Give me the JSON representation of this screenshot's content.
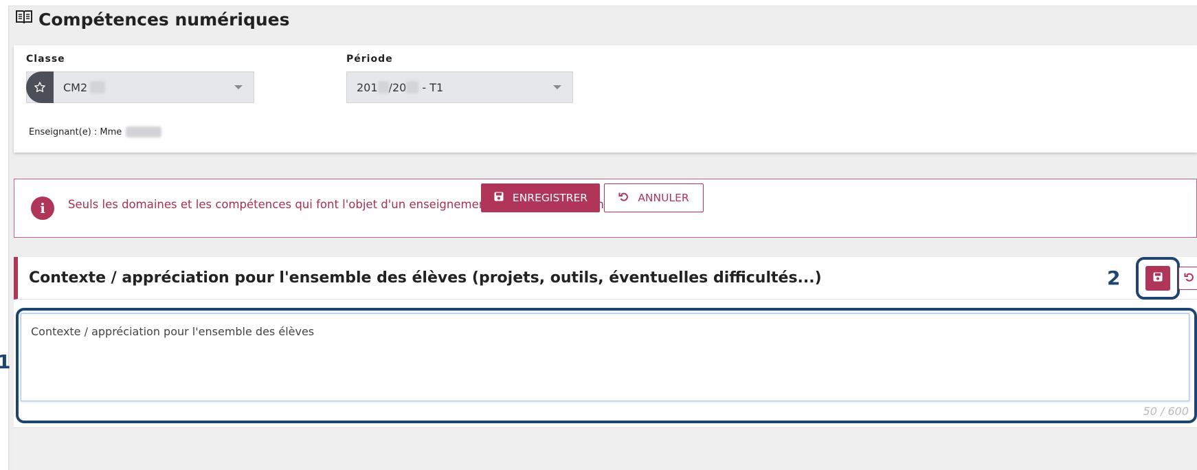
{
  "page": {
    "title": "Compétences numériques",
    "title_icon": "book-open-icon"
  },
  "filters": {
    "classe_label": "Classe",
    "classe_value": "CM2",
    "classe_icon": "star-icon",
    "periode_label": "Période",
    "periode_value_part1": "201",
    "periode_value_part2": "/20",
    "periode_value_part3": " - T1",
    "teacher_label": "Enseignant(e) : Mme"
  },
  "info": {
    "icon": "info-icon",
    "message": "Seuls les domaines et les compétences qui font l'objet d'un enseignement et d'une évaluation sont mentionnés"
  },
  "section": {
    "title": "Contexte / appréciation pour l'ensemble des élèves (projets, outils, éventuelles difficultés...)",
    "textarea_value": "Contexte / appréciation pour l'ensemble des élèves",
    "counter": "50 / 600",
    "callout_1": "1",
    "callout_2": "2",
    "save_icon": "save-icon",
    "undo_icon": "undo-icon"
  },
  "actions": {
    "save_label": "ENREGISTRER",
    "cancel_label": "ANNULER"
  },
  "colors": {
    "accent": "#b13459",
    "callout": "#1d4570",
    "info_text": "#a8304f"
  }
}
